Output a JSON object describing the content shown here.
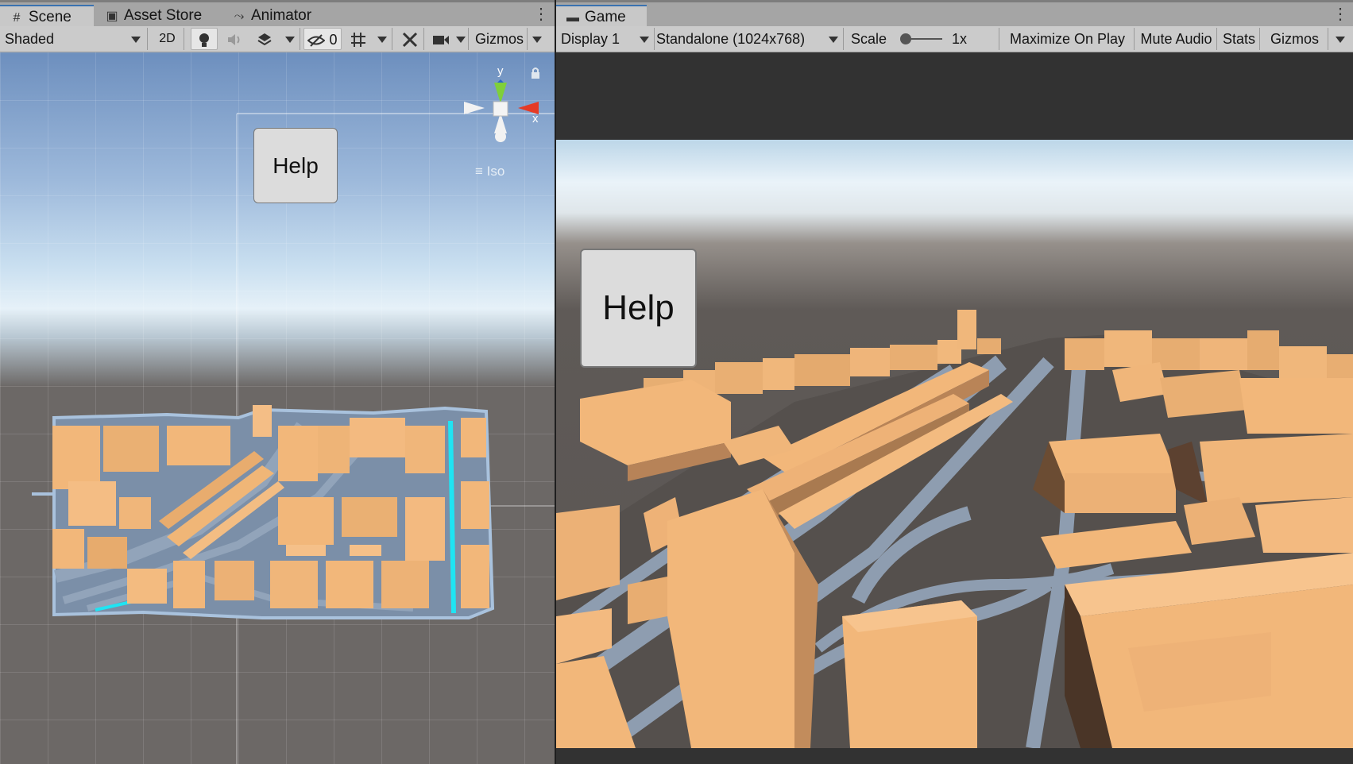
{
  "scene_panel": {
    "tabs": [
      {
        "label": "Scene",
        "icon": "grid-icon",
        "active": true
      },
      {
        "label": "Asset Store",
        "icon": "shopping-bag-icon",
        "active": false
      },
      {
        "label": "Animator",
        "icon": "animator-icon",
        "active": false
      }
    ],
    "toolbar": {
      "draw_mode": "Shaded",
      "toggle_2d": "2D",
      "hidden_count": "0",
      "gizmos_label": "Gizmos"
    },
    "gizmo": {
      "y_axis": "y",
      "x_axis": "x",
      "projection": "Iso"
    },
    "help_button": "Help"
  },
  "game_panel": {
    "tab": {
      "label": "Game",
      "icon": "gamepad-icon"
    },
    "toolbar": {
      "display": "Display 1",
      "resolution": "Standalone (1024x768)",
      "scale_label": "Scale",
      "scale_value": "1x",
      "maximize": "Maximize On Play",
      "mute": "Mute Audio",
      "stats": "Stats",
      "gizmos": "Gizmos"
    },
    "help_button": "Help"
  },
  "colors": {
    "building": "#f2b77a",
    "road": "#8a9bb0",
    "highlight": "#1fe4f3",
    "ground": "#6c6866"
  }
}
